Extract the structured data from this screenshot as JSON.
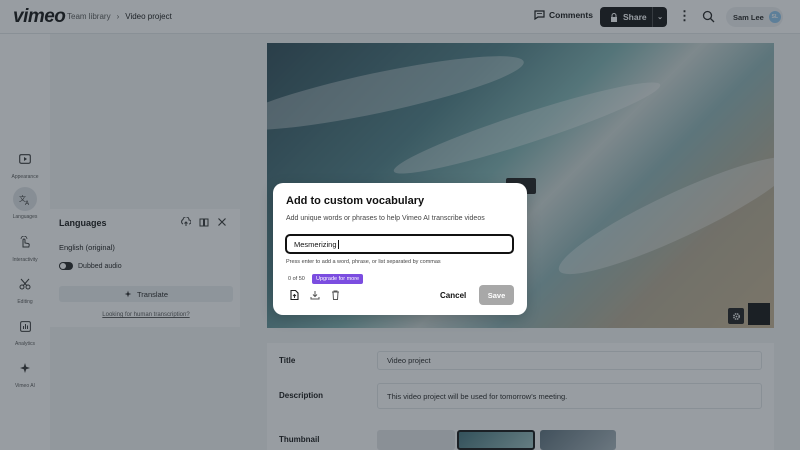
{
  "header": {
    "logo": "vimeo",
    "breadcrumb": [
      "Team library",
      "Video project"
    ],
    "comments_label": "Comments",
    "share_label": "Share",
    "user_name": "Sam Lee",
    "user_initials": "SL"
  },
  "rail": {
    "items": [
      {
        "label": "Appearance",
        "icon": "appearance-icon"
      },
      {
        "label": "Languages",
        "icon": "languages-icon"
      },
      {
        "label": "Interactivity",
        "icon": "interactivity-icon"
      },
      {
        "label": "Editing",
        "icon": "scissors-icon"
      },
      {
        "label": "Analytics",
        "icon": "analytics-icon"
      },
      {
        "label": "Vimeo AI",
        "icon": "sparkle-icon"
      }
    ]
  },
  "languages_panel": {
    "title": "Languages",
    "original_language": "English (original)",
    "dubbed_audio_label": "Dubbed audio",
    "translate_label": "Translate",
    "human_link": "Looking for human transcription?"
  },
  "video_details": {
    "title_label": "Title",
    "title_value": "Video project",
    "description_label": "Description",
    "description_value": "This video project will be used for tomorrow's meeting.",
    "thumbnail_label": "Thumbnail"
  },
  "modal": {
    "title": "Add to custom vocabulary",
    "description": "Add unique words or phrases to help Vimeo AI transcribe videos",
    "input_value": "Mesmerizing",
    "hint": "Press enter to add a word, phrase, or list separated by commas",
    "count": "0 of 50",
    "upgrade_label": "Upgrade for more",
    "cancel_label": "Cancel",
    "save_label": "Save"
  },
  "colors": {
    "accent_purple": "#7b4de0",
    "share_bg": "#111111"
  }
}
